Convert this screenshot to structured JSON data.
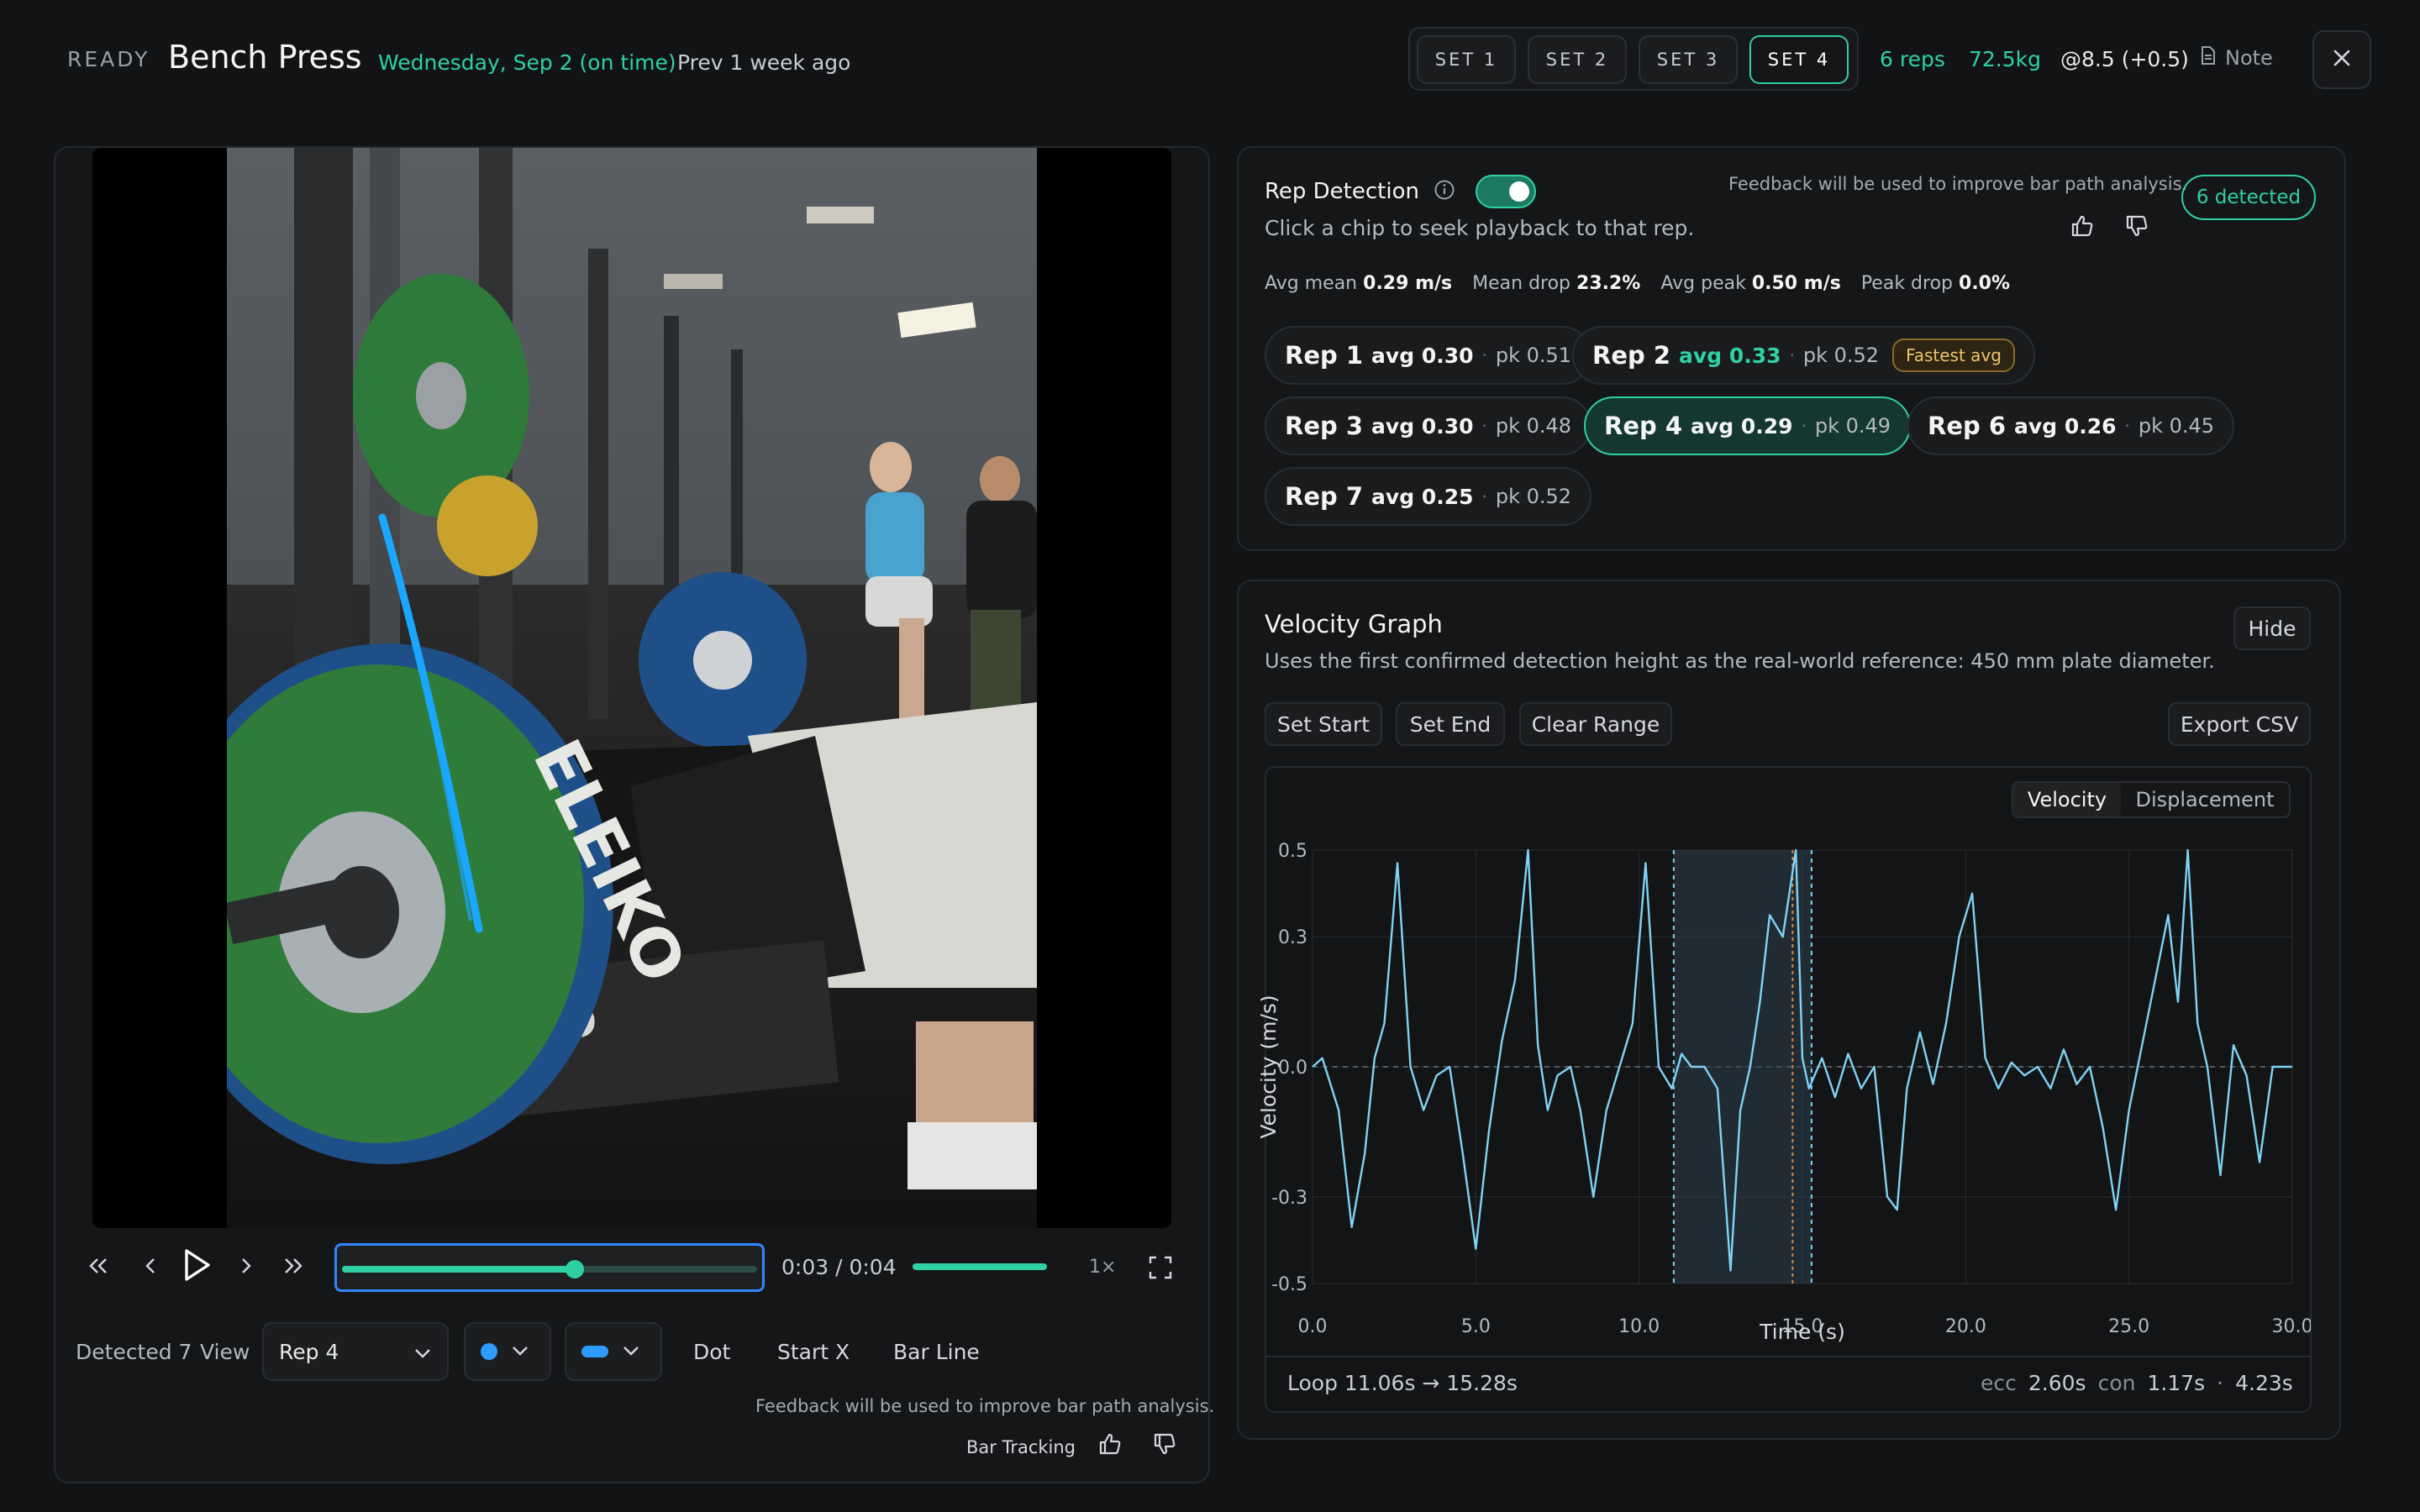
{
  "header": {
    "status": "READY",
    "title": "Bench Press",
    "date": "Wednesday, Sep 2 (on time)",
    "prev": "Prev 1 week ago",
    "sets": [
      "SET 1",
      "SET 2",
      "SET 3",
      "SET 4"
    ],
    "active_set": 3,
    "reps": "6 reps",
    "weight": "72.5kg",
    "rpe": "@8.5 (+0.5)",
    "note_label": "Note"
  },
  "player": {
    "time": "0:03 / 0:04",
    "speed": "1×",
    "progress": 0.56,
    "volume": 1.0,
    "detected": "Detected 7",
    "view_label": "View",
    "view_value": "Rep 4",
    "dot_color": "#2f9bff",
    "line_color": "#2f9bff",
    "toggles": [
      "Dot",
      "Start X",
      "Bar Line"
    ],
    "feedback_note": "Feedback will be used to improve bar path analysis.",
    "bar_tracking": "Bar Tracking"
  },
  "rep_detection": {
    "title": "Rep Detection",
    "subtitle": "Click a chip to seek playback to that rep.",
    "feedback_note": "Feedback will be used to improve bar path analysis.",
    "badge": "6 detected",
    "stats": [
      {
        "label": "Avg mean",
        "value": "0.29 m/s"
      },
      {
        "label": "Mean drop",
        "value": "23.2%"
      },
      {
        "label": "Avg peak",
        "value": "0.50 m/s"
      },
      {
        "label": "Peak drop",
        "value": "0.0%"
      }
    ],
    "chips": [
      {
        "rep": "Rep 1",
        "avg": "avg 0.30",
        "pk": "pk 0.51",
        "badge": ""
      },
      {
        "rep": "Rep 2",
        "avg": "avg 0.33",
        "pk": "pk 0.52",
        "badge": "Fastest avg"
      },
      {
        "rep": "Rep 3",
        "avg": "avg 0.30",
        "pk": "pk 0.48",
        "badge": ""
      },
      {
        "rep": "Rep 4",
        "avg": "avg 0.29",
        "pk": "pk 0.49",
        "badge": ""
      },
      {
        "rep": "Rep 6",
        "avg": "avg 0.26",
        "pk": "pk 0.45",
        "badge": ""
      },
      {
        "rep": "Rep 7",
        "avg": "avg 0.25",
        "pk": "pk 0.52",
        "badge": ""
      }
    ]
  },
  "velocity_graph": {
    "title": "Velocity Graph",
    "hide_label": "Hide",
    "subtitle": "Uses the first confirmed detection height as the real-world reference: 450 mm plate diameter.",
    "buttons": [
      "Set Start",
      "Set End",
      "Clear Range"
    ],
    "export_label": "Export CSV",
    "modes": [
      "Velocity",
      "Displacement"
    ],
    "loop": "Loop 11.06s → 15.28s",
    "ecc_label": "ecc",
    "ecc_value": "2.60s",
    "con_label": "con",
    "con_value": "1.17s",
    "total": "4.23s"
  },
  "chart_data": {
    "type": "line",
    "xlabel": "Time (s)",
    "ylabel": "Velocity (m/s)",
    "xlim": [
      0,
      30
    ],
    "ylim": [
      -0.5,
      0.5
    ],
    "xticks": [
      "0.0",
      "5.0",
      "10.0",
      "15.0",
      "20.0",
      "25.0",
      "30.0"
    ],
    "yticks": [
      "0.5",
      "0.3",
      "0.0",
      "-0.3",
      "-0.5"
    ],
    "highlight_range": [
      11.06,
      15.28
    ],
    "marker_x": 14.7,
    "series": [
      {
        "color": "#7fd3f5",
        "x": [
          0,
          0.3,
          0.8,
          1.2,
          1.6,
          1.9,
          2.2,
          2.6,
          3.0,
          3.4,
          3.8,
          4.2,
          4.6,
          5.0,
          5.4,
          5.8,
          6.2,
          6.6,
          6.9,
          7.2,
          7.5,
          7.9,
          8.2,
          8.6,
          9.0,
          9.4,
          9.8,
          10.2,
          10.6,
          11.0,
          11.3,
          11.6,
          12.0,
          12.4,
          12.8,
          13.1,
          13.4,
          13.7,
          14.0,
          14.4,
          14.8,
          15.0,
          15.2,
          15.6,
          16.0,
          16.4,
          16.8,
          17.2,
          17.6,
          17.9,
          18.2,
          18.6,
          19.0,
          19.4,
          19.8,
          20.2,
          20.6,
          21.0,
          21.4,
          21.8,
          22.2,
          22.6,
          23.0,
          23.4,
          23.8,
          24.2,
          24.6,
          25.0,
          25.4,
          25.8,
          26.2,
          26.5,
          26.8,
          27.1,
          27.4,
          27.8,
          28.2,
          28.6,
          29.0,
          29.4,
          29.8,
          30.0
        ],
        "y": [
          0.0,
          0.02,
          -0.1,
          -0.37,
          -0.2,
          0.02,
          0.1,
          0.47,
          0.0,
          -0.1,
          -0.02,
          0.0,
          -0.2,
          -0.42,
          -0.15,
          0.06,
          0.2,
          0.5,
          0.05,
          -0.1,
          -0.02,
          0.0,
          -0.1,
          -0.3,
          -0.1,
          0.0,
          0.1,
          0.47,
          0.0,
          -0.05,
          0.03,
          0.0,
          0.0,
          -0.05,
          -0.47,
          -0.1,
          0.0,
          0.15,
          0.35,
          0.3,
          0.5,
          0.02,
          -0.05,
          0.02,
          -0.07,
          0.03,
          -0.05,
          0.0,
          -0.3,
          -0.33,
          -0.05,
          0.08,
          -0.04,
          0.1,
          0.3,
          0.4,
          0.02,
          -0.05,
          0.01,
          -0.02,
          0.0,
          -0.05,
          0.04,
          -0.04,
          0.0,
          -0.14,
          -0.33,
          -0.1,
          0.05,
          0.2,
          0.35,
          0.15,
          0.5,
          0.1,
          0.0,
          -0.25,
          0.05,
          -0.02,
          -0.22,
          0.0,
          0.0,
          0.0
        ]
      }
    ]
  }
}
